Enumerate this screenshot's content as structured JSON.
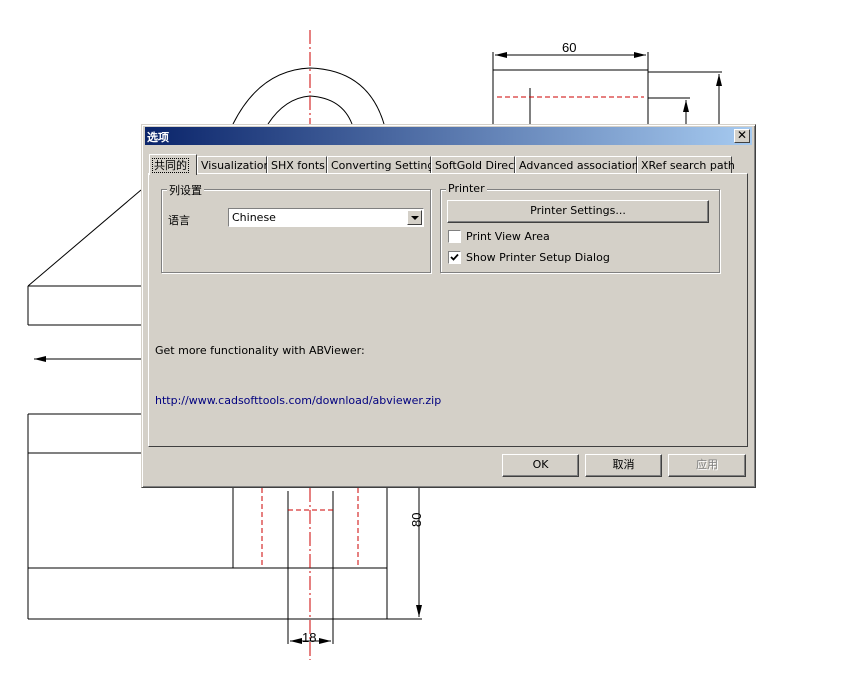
{
  "background_drawing": {
    "dimensions": [
      "60",
      "80",
      "18"
    ]
  },
  "dialog": {
    "title": "选项",
    "close_glyph": "✕",
    "tabs": [
      {
        "label": "共同的",
        "active": true
      },
      {
        "label": "Visualization",
        "active": false
      },
      {
        "label": "SHX fonts",
        "active": false
      },
      {
        "label": "Converting Settings",
        "active": false
      },
      {
        "label": "SoftGold Direct",
        "active": false
      },
      {
        "label": "Advanced associations",
        "active": false
      },
      {
        "label": "XRef search path",
        "active": false
      }
    ],
    "column_settings": {
      "legend": "列设置",
      "language_label": "语言",
      "language_value": "Chinese"
    },
    "printer": {
      "legend": "Printer",
      "settings_button": "Printer Settings...",
      "print_view_area": {
        "label": "Print View Area",
        "checked": false
      },
      "show_setup_dialog": {
        "label": "Show Printer Setup Dialog",
        "checked": true
      }
    },
    "promo_text": "Get more functionality with ABViewer:",
    "promo_link": "http://www.cadsofttools.com/download/abviewer.zip",
    "buttons": {
      "ok": "OK",
      "cancel": "取消",
      "apply": "应用"
    }
  },
  "colors": {
    "title_start": "#0a246a",
    "title_end": "#a6caf0",
    "face": "#d4d0c8",
    "link": "#00007f",
    "centerline": "#cc0000"
  }
}
